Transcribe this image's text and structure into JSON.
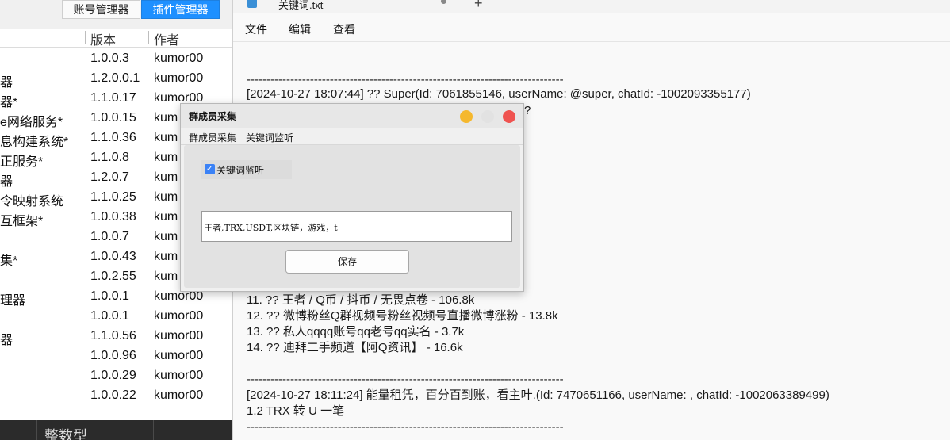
{
  "plugin_manager": {
    "tabs": [
      {
        "label": "账号管理器"
      },
      {
        "label": "插件管理器"
      }
    ],
    "columns": {
      "version": "版本",
      "author": "作者"
    },
    "rows": [
      {
        "name": "",
        "version": "1.0.0.3",
        "author": "kumor00"
      },
      {
        "name": "器",
        "version": "1.2.0.0.1",
        "author": "kumor00"
      },
      {
        "name": "器*",
        "version": "1.1.0.17",
        "author": "kumor00"
      },
      {
        "name": "e网络服务*",
        "version": "1.0.0.15",
        "author": "kum"
      },
      {
        "name": "息构建系统*",
        "version": "1.1.0.36",
        "author": "kum"
      },
      {
        "name": "正服务*",
        "version": "1.1.0.8",
        "author": "kum"
      },
      {
        "name": "器",
        "version": "1.2.0.7",
        "author": "kum"
      },
      {
        "name": "令映射系统",
        "version": "1.1.0.25",
        "author": "kum"
      },
      {
        "name": "互框架*",
        "version": "1.0.0.38",
        "author": "kum"
      },
      {
        "name": "",
        "version": "1.0.0.7",
        "author": "kum"
      },
      {
        "name": "集*",
        "version": "1.0.0.43",
        "author": "kum"
      },
      {
        "name": "",
        "version": "1.0.2.55",
        "author": "kum"
      },
      {
        "name": "理器",
        "version": "1.0.0.1",
        "author": "kumor00"
      },
      {
        "name": "",
        "version": "1.0.0.1",
        "author": "kumor00"
      },
      {
        "name": "器",
        "version": "1.1.0.56",
        "author": "kumor00"
      },
      {
        "name": "",
        "version": "1.0.0.96",
        "author": "kumor00"
      },
      {
        "name": "",
        "version": "1.0.0.29",
        "author": "kumor00"
      },
      {
        "name": "",
        "version": "1.0.0.22",
        "author": "kumor00"
      }
    ],
    "bottom_label": "整数型"
  },
  "notepad": {
    "tab_title": "关键词.txt",
    "menu": [
      "文件",
      "编辑",
      "查看"
    ],
    "lines": [
      {
        "text": "--------------------------------------------------------------------------------"
      },
      {
        "text": "[2024-10-27 18:07:44] ?? Super(Id: 7061855146, userName: @super, chatId: -1002093355177)"
      },
      {
        "text": "?"
      },
      {
        "text": "11. ?? 王者 / Q币 / 抖币 / 无畏点卷 - 106.8k"
      },
      {
        "text": "12. ?? 微博粉丝Q群视频号粉丝视频号直播微博涨粉 - 13.8k"
      },
      {
        "text": "13. ?? 私人qqqq账号qq老号qq实名 - 3.7k"
      },
      {
        "text": "14. ?? 迪拜二手频道【阿Q资讯】 - 16.6k"
      },
      {
        "text": "--------------------------------------------------------------------------------"
      },
      {
        "text": "[2024-10-27 18:11:24] 能量租凭，百分百到账，看主叶.(Id: 7470651166, userName: , chatId: -1002063389499)"
      },
      {
        "text": "1.2 TRX 转 U 一笔"
      },
      {
        "text": "--------------------------------------------------------------------------------"
      }
    ]
  },
  "dialog": {
    "title": "群成员采集",
    "menu": [
      "群成员采集",
      "关键词监听"
    ],
    "checkbox": {
      "label": "关键词监听",
      "checked": true
    },
    "keywords_value": "王者,TRX,USDT,区块链，游戏，t",
    "save_label": "保存",
    "colors": {
      "minimize": "#f5b82e",
      "maximize": "#e2e2e2",
      "close": "#ef5350"
    }
  }
}
